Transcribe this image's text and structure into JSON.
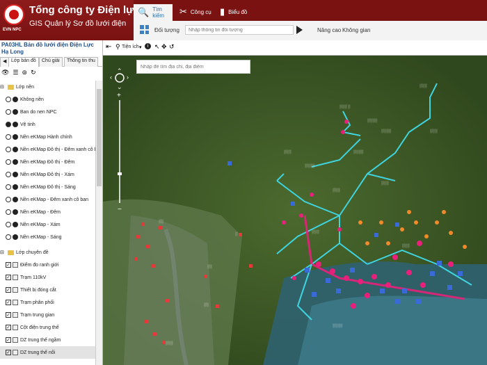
{
  "header": {
    "title": "Tổng công ty Điện lực miền Bắc",
    "subtitle": "GIS Quản lý Sơ đồ lưới điện",
    "logo_text": "EVN NPC"
  },
  "tabs": [
    {
      "label": "Tìm kiếm",
      "icon": "search-icon"
    },
    {
      "label": "Công cụ",
      "icon": "tools-icon"
    },
    {
      "label": "Biểu đồ",
      "icon": "chart-icon"
    }
  ],
  "toolrow": {
    "object_label": "Đối tượng",
    "search_placeholder": "Nhập thông tin đối tượng",
    "advanced": "Nâng cao",
    "space": "Không gian"
  },
  "sidebar": {
    "panel_title": "PA03HL Bản đồ lưới điện Điện Lực Hạ Long",
    "subtabs": [
      "Lớp bản đồ",
      "Chú giải",
      "Thông tin thu"
    ],
    "base_group": "Lớp nền",
    "base_layers": [
      "Không nền",
      "Ban do nen NPC",
      "Vệ tinh",
      "Nền eKMap Hành chính",
      "Nền eKMap Đô thị - Đêm xanh cô ban",
      "Nền eKMap Đô thị - Đêm",
      "Nền eKMap Đô thị - Xám",
      "Nền eKMap Đô thị - Sáng",
      "Nền eKMap - Đêm xanh cô ban",
      "Nền eKMap - Đêm",
      "Nền eKMap - Xám",
      "Nền eKMap - Sáng"
    ],
    "topic_group": "Lớp chuyên đề",
    "topic_layers": [
      "Điểm đo ranh giới",
      "Trạm 110kV",
      "Thiết bị đóng cắt",
      "Trạm phân phối",
      "Trạm trung gian",
      "Cột điện trung thế",
      "DZ trung thế ngầm",
      "DZ trung thế nổi"
    ],
    "selected_base": "Vệ tinh"
  },
  "map_tools": {
    "utility_label": "Tiện ích"
  },
  "map": {
    "address_placeholder": "Nhập để tìm địa chỉ, địa điểm"
  },
  "colors": {
    "header_red": "#7a1212",
    "active_tab_blue": "#2a6fb0",
    "line_cyan": "#3fd4e0",
    "marker_pink": "#e8207a",
    "marker_blue": "#3a6ad8",
    "marker_orange": "#f08a2a"
  }
}
